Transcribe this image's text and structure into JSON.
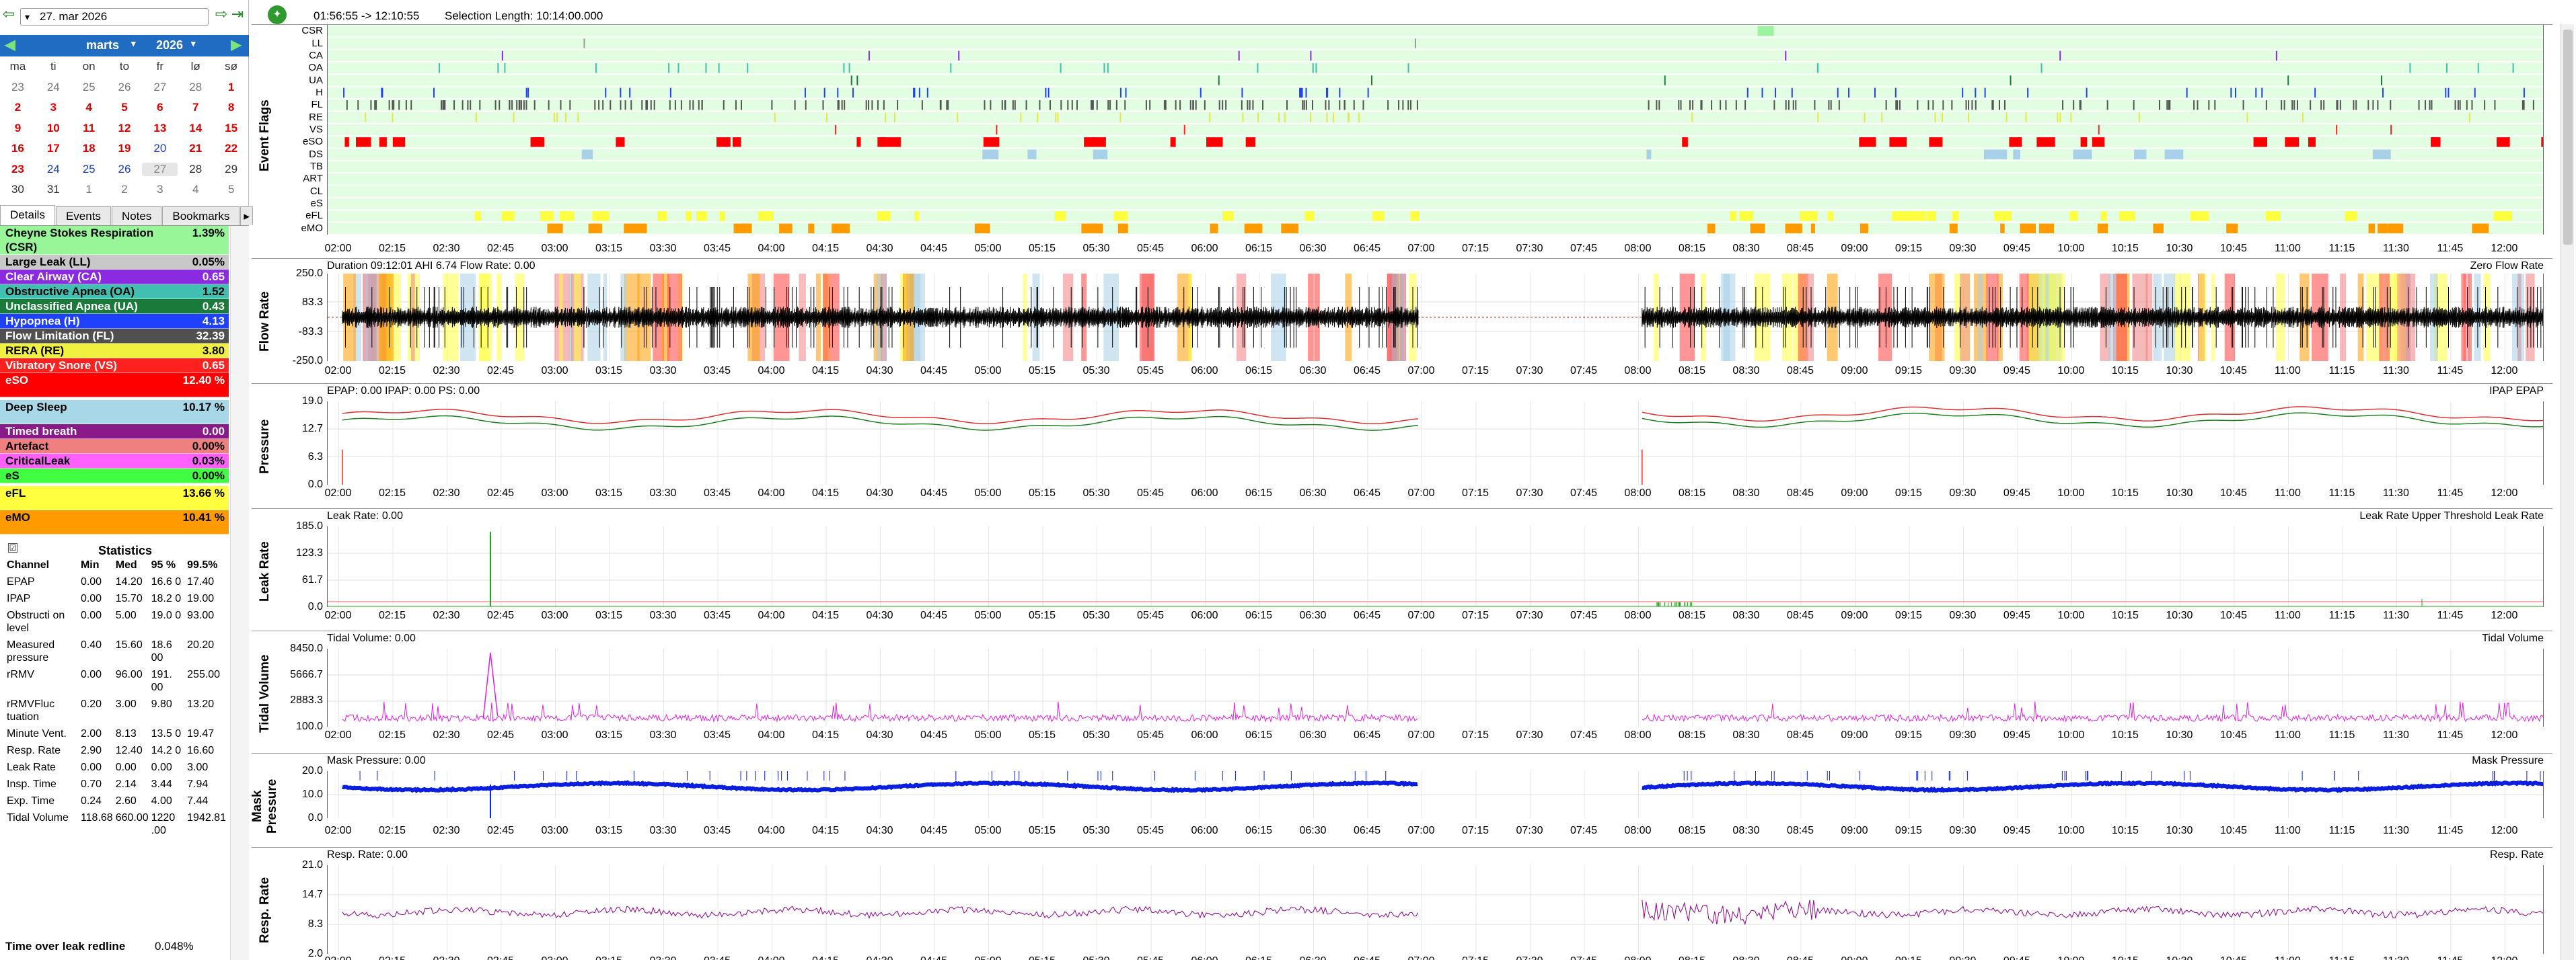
{
  "sidebar": {
    "date": "27. mar 2026",
    "month": "marts",
    "year": "2026",
    "weekdays": [
      "ma",
      "ti",
      "on",
      "to",
      "fr",
      "lø",
      "sø"
    ],
    "weeks": [
      [
        "23",
        "24",
        "25",
        "26",
        "27",
        "28",
        "1"
      ],
      [
        "2",
        "3",
        "4",
        "5",
        "6",
        "7",
        "8"
      ],
      [
        "9",
        "10",
        "11",
        "12",
        "13",
        "14",
        "15"
      ],
      [
        "16",
        "17",
        "18",
        "19",
        "20",
        "21",
        "22"
      ],
      [
        "23",
        "24",
        "25",
        "26",
        "27",
        "28",
        "29"
      ],
      [
        "30",
        "31",
        "1",
        "2",
        "3",
        "4",
        "5"
      ]
    ],
    "tabs": [
      "Details",
      "Events",
      "Notes",
      "Bookmarks"
    ],
    "summary": [
      {
        "label": "Cheyne Stokes Respiration (CSR)",
        "value": "1.39%",
        "bg": "#98f598",
        "fg": "#000"
      },
      {
        "label": "Large Leak (LL)",
        "value": "0.05%",
        "bg": "#c8c8c8",
        "fg": "#000"
      },
      {
        "label": "Clear Airway (CA)",
        "value": "0.65",
        "bg": "#8a2be2",
        "fg": "#fff"
      },
      {
        "label": "Obstructive Apnea (OA)",
        "value": "1.52",
        "bg": "#40c0b0",
        "fg": "#000"
      },
      {
        "label": "Unclassified Apnea (UA)",
        "value": "0.43",
        "bg": "#1a7a3a",
        "fg": "#fff"
      },
      {
        "label": "Hypopnea (H)",
        "value": "4.13",
        "bg": "#2040ff",
        "fg": "#fff"
      },
      {
        "label": "Flow Limitation (FL)",
        "value": "32.39",
        "bg": "#505050",
        "fg": "#fff"
      },
      {
        "label": "RERA (RE)",
        "value": "3.80",
        "bg": "#f0f040",
        "fg": "#000"
      },
      {
        "label": "Vibratory Snore (VS)",
        "value": "0.65",
        "bg": "#ff2020",
        "fg": "#fff"
      },
      {
        "label": "eSO",
        "value": "12.40 %",
        "bg": "#ff0000",
        "fg": "#fff"
      },
      {
        "label": "Deep Sleep",
        "value": "10.17 %",
        "bg": "#a8d8e8",
        "fg": "#000"
      },
      {
        "label": "Timed breath",
        "value": "0.00",
        "bg": "#8a1a8a",
        "fg": "#fff"
      },
      {
        "label": "Artefact",
        "value": "0.00%",
        "bg": "#f08080",
        "fg": "#000"
      },
      {
        "label": "CriticalLeak",
        "value": "0.03%",
        "bg": "#ff60ff",
        "fg": "#000"
      },
      {
        "label": "eS",
        "value": "0.00%",
        "bg": "#40ff40",
        "fg": "#000"
      },
      {
        "label": "eFL",
        "value": "13.66 %",
        "bg": "#ffff40",
        "fg": "#000"
      },
      {
        "label": "eMO",
        "value": "10.41 %",
        "bg": "#ff9a00",
        "fg": "#000"
      }
    ],
    "stats_title": "Statistics",
    "stats_headers": [
      "Channel",
      "Min",
      "Med",
      "95 %",
      "99.5%"
    ],
    "stats_rows": [
      [
        "EPAP",
        "0.00",
        "14.20",
        "16.6 0",
        "17.40"
      ],
      [
        "IPAP",
        "0.00",
        "15.70",
        "18.2 0",
        "19.00"
      ],
      [
        "Obstructi on level",
        "0.00",
        "5.00",
        "19.0 0",
        "93.00"
      ],
      [
        "Measured pressure",
        "0.40",
        "15.60",
        "18.6 00",
        "20.20"
      ],
      [
        "rRMV",
        "0.00",
        "96.00",
        "191. 00",
        "255.00"
      ],
      [
        "rRMVFluc tuation",
        "0.20",
        "3.00",
        "9.80",
        "13.20"
      ],
      [
        "Minute Vent.",
        "2.00",
        "8.13",
        "13.5 0",
        "19.47"
      ],
      [
        "Resp. Rate",
        "2.90",
        "12.40",
        "14.2 0",
        "16.60"
      ],
      [
        "Leak Rate",
        "0.00",
        "0.00",
        "0.00",
        "3.00"
      ],
      [
        "Insp. Time",
        "0.70",
        "2.14",
        "3.44",
        "7.94"
      ],
      [
        "Exp. Time",
        "0.24",
        "2.60",
        "4.00",
        "7.44"
      ],
      [
        "Tidal Volume",
        "118.68",
        "660.00",
        "1220 .00",
        "1942.81"
      ]
    ],
    "leak_redline_label": "Time over leak redline",
    "leak_redline_value": "0.048%"
  },
  "header": {
    "range": "01:56:55 -> 12:10:55",
    "selection": "Selection Length: 10:14:00.000"
  },
  "x_ticks": [
    "02:00",
    "02:15",
    "02:30",
    "02:45",
    "03:00",
    "03:15",
    "03:30",
    "03:45",
    "04:00",
    "04:15",
    "04:30",
    "04:45",
    "05:00",
    "05:15",
    "05:30",
    "05:45",
    "06:00",
    "06:15",
    "06:30",
    "06:45",
    "07:00",
    "07:15",
    "07:30",
    "07:45",
    "08:00",
    "08:15",
    "08:30",
    "08:45",
    "09:00",
    "09:15",
    "09:30",
    "09:45",
    "10:00",
    "10:15",
    "10:30",
    "10:45",
    "11:00",
    "11:15",
    "11:30",
    "11:45",
    "12:00"
  ],
  "flags": {
    "title": "Event Flags",
    "rows": [
      "CSR",
      "LL",
      "CA",
      "OA",
      "UA",
      "H",
      "FL",
      "RE",
      "VS",
      "eSO",
      "DS",
      "TB",
      "ART",
      "CL",
      "eS",
      "eFL",
      "eMO"
    ]
  },
  "flow": {
    "ylabel": "Flow Rate",
    "info": "Duration 09:12:01 AHI 6.74 Flow Rate: 0.00",
    "legend": "Zero  Flow Rate",
    "yticks": [
      "250.0",
      "83.3",
      "-83.3",
      "-250.0"
    ]
  },
  "pressure": {
    "ylabel": "Pressure",
    "info": "EPAP: 0.00 IPAP: 0.00 PS: 0.00",
    "legend": "IPAP  EPAP",
    "yticks": [
      "19.0",
      "12.7",
      "6.3",
      "0.0"
    ],
    "colors": {
      "ipap": "#e03030",
      "epap": "#208020"
    }
  },
  "leak": {
    "ylabel": "Leak Rate",
    "info": "Leak Rate: 0.00",
    "legend": "Leak Rate Upper Threshold  Leak Rate",
    "yticks": [
      "185.0",
      "123.3",
      "61.7",
      "0.0"
    ]
  },
  "tidal": {
    "ylabel": "Tidal Volume",
    "info": "Tidal Volume: 0.00",
    "legend": "Tidal Volume",
    "yticks": [
      "8450.0",
      "5666.7",
      "2883.3",
      "100.0"
    ]
  },
  "mask": {
    "ylabel": "Mask Pressure",
    "info": "Mask Pressure: 0.00",
    "legend": "Mask Pressure",
    "yticks": [
      "20.0",
      "10.0",
      "0.0"
    ]
  },
  "resp": {
    "ylabel": "Resp. Rate",
    "info": "Resp. Rate: 0.00",
    "legend": "Resp. Rate",
    "yticks": [
      "21.0",
      "14.7",
      "8.3",
      "2.0"
    ]
  }
}
